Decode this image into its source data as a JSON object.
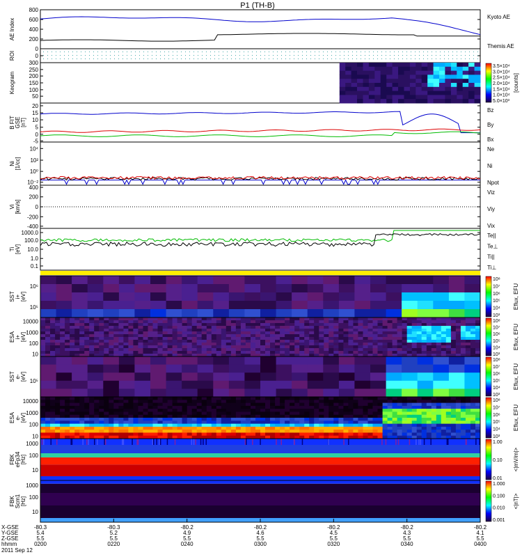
{
  "title": "P1 (TH-B)",
  "date": "2011 Sep 12",
  "ephem_labels": [
    "X-GSE",
    "Y-GSE",
    "Z-GSE",
    "hhmm"
  ],
  "ephem_values": {
    "x": [
      "-80.3",
      "-80.3",
      "-80.2",
      "-80.2",
      "-80.2",
      "-80.2",
      "-80.2"
    ],
    "y": [
      "5.4",
      "5.2",
      "4.9",
      "4.6",
      "4.5",
      "4.3",
      "4.1"
    ],
    "z": [
      "5.5",
      "5.5",
      "5.5",
      "5.5",
      "5.5",
      "5.5",
      "5.5"
    ],
    "hhmm": [
      "0200",
      "0220",
      "0240",
      "0300",
      "0320",
      "0340",
      "0400"
    ]
  },
  "colors": {
    "blue": "#0000cc",
    "red": "#dd0000",
    "green": "#00bb00",
    "black": "#000000",
    "yellow": "#ffee00"
  },
  "panels": [
    {
      "id": "ae",
      "ylabel": [
        "AE Index"
      ],
      "ticks": [
        "800",
        "600",
        "400",
        "200",
        "0"
      ],
      "legend": [
        {
          "text": "Kyoto AE",
          "color": "#0000cc"
        },
        {
          "text": "Themis AE",
          "color": "#000000"
        }
      ]
    },
    {
      "id": "roi",
      "ylabel": [
        "ROI"
      ],
      "ticks": [
        "0"
      ],
      "legend": []
    },
    {
      "id": "keogram",
      "ylabel": [
        "Keogram"
      ],
      "ticks": [
        "300",
        "250",
        "200",
        "150",
        "100",
        "50"
      ],
      "legend": []
    },
    {
      "id": "bfield",
      "ylabel": [
        "B FIT",
        "GSE",
        "[nT]"
      ],
      "ticks": [
        "20",
        "15",
        "10",
        "5",
        "0",
        "-5"
      ],
      "legend": [
        {
          "text": "Bz",
          "color": "#dd0000"
        },
        {
          "text": "By",
          "color": "#00bb00"
        },
        {
          "text": "Bx",
          "color": "#0000cc"
        }
      ]
    },
    {
      "id": "density",
      "ylabel": [
        "Ni",
        "[1/cc]"
      ],
      "ticks": [
        "10⁴",
        "10²",
        "10⁰",
        "10⁻²"
      ],
      "legend": [
        {
          "text": "Ne",
          "color": "#dd0000"
        },
        {
          "text": "Ni",
          "color": "#000000"
        },
        {
          "text": "Npot",
          "color": "#0000cc"
        }
      ]
    },
    {
      "id": "velocity",
      "ylabel": [
        "Vi",
        "[km/s]"
      ],
      "ticks": [
        "400",
        "200",
        "0",
        "-200",
        "-400"
      ],
      "legend": [
        {
          "text": "Viz",
          "color": "#dd0000"
        },
        {
          "text": "Viy",
          "color": "#00bb00"
        },
        {
          "text": "Vix",
          "color": "#0000cc"
        }
      ]
    },
    {
      "id": "temperature",
      "ylabel": [
        "Ti",
        "[eV]"
      ],
      "ticks": [
        "1000.0",
        "100.0",
        "10.0",
        "1.0",
        "0.1"
      ],
      "legend": [
        {
          "text": "Te||",
          "color": "#000000"
        },
        {
          "text": "Te⊥",
          "color": "#dd0000"
        },
        {
          "text": "Ti||",
          "color": "#00bb00"
        },
        {
          "text": "Ti⊥",
          "color": "#0000cc"
        }
      ]
    },
    {
      "id": "sst_ion",
      "ylabel": [
        "SST",
        "i+",
        "[eV]"
      ],
      "ticks": [
        "10⁶",
        "10⁵"
      ],
      "legend": []
    },
    {
      "id": "esa_ion",
      "ylabel": [
        "ESA",
        "i+",
        "[eV]"
      ],
      "ticks": [
        "10000",
        "1000",
        "100",
        "10"
      ],
      "legend": []
    },
    {
      "id": "sst_e",
      "ylabel": [
        "SST",
        "e-",
        "[eV]"
      ],
      "ticks": [
        "10⁵"
      ],
      "legend": []
    },
    {
      "id": "esa_e",
      "ylabel": [
        "ESA",
        "e-",
        "[eV]"
      ],
      "ticks": [
        "10000",
        "1000",
        "100",
        "10"
      ],
      "legend": []
    },
    {
      "id": "fbk_e",
      "ylabel": [
        "FBK",
        "eFp34",
        "[Hz]"
      ],
      "ticks": [
        "1000",
        "100",
        "10"
      ],
      "legend": []
    },
    {
      "id": "fbk_b",
      "ylabel": [
        "FBK",
        "Scm1",
        "[Hz]"
      ],
      "ticks": [
        "1000",
        "100",
        "10"
      ],
      "legend": []
    }
  ],
  "colorbars": [
    {
      "id": "cb_keo",
      "ticks": [
        "3.5×10⁴",
        "3.0×10⁴",
        "2.5×10⁴",
        "2.0×10⁴",
        "1.5×10⁴",
        "1.0×10⁴",
        "5.0×10³"
      ],
      "label": "[counts]"
    },
    {
      "id": "cb_sst_i",
      "ticks": [
        "10⁸",
        "10⁷",
        "10⁶",
        "10⁵",
        "10⁴",
        "10³"
      ],
      "label": "Eflux, EFU"
    },
    {
      "id": "cb_esa_i",
      "ticks": [
        "10⁸",
        "10⁷",
        "10⁶",
        "10⁵",
        "10⁴",
        "10³"
      ],
      "label": "Eflux, EFU"
    },
    {
      "id": "cb_sst_e",
      "ticks": [
        "10⁸",
        "10⁷",
        "10⁶",
        "10⁵",
        "10⁴",
        "10³"
      ],
      "label": "Eflux, EFU"
    },
    {
      "id": "cb_esa_e",
      "ticks": [
        "10⁸",
        "10⁷",
        "10⁶",
        "10⁵",
        "10⁴",
        "10³"
      ],
      "label": "Eflux, EFU"
    },
    {
      "id": "cb_fbk_e",
      "ticks": [
        "1.00",
        "0.10",
        "0.01"
      ],
      "label": "<|mV/m|>"
    },
    {
      "id": "cb_fbk_b",
      "ticks": [
        "1.000",
        "0.100",
        "0.010",
        "0.001"
      ],
      "label": "<|nT|>"
    }
  ],
  "chart_data": {
    "type": "line",
    "title": "P1 (TH-B)",
    "x": [
      "0200",
      "0220",
      "0240",
      "0300",
      "0320",
      "0340",
      "0400"
    ],
    "series": [
      {
        "name": "Kyoto AE",
        "values": [
          650,
          640,
          690,
          670,
          640,
          530,
          300
        ]
      },
      {
        "name": "Themis AE",
        "values": [
          160,
          180,
          300,
          310,
          300,
          250,
          240
        ]
      },
      {
        "name": "Bz",
        "values": [
          2,
          2,
          4,
          4,
          3,
          2,
          1
        ]
      },
      {
        "name": "By",
        "values": [
          -2,
          -2,
          -1,
          -1,
          -1,
          -1,
          0
        ]
      },
      {
        "name": "Bx",
        "values": [
          13,
          14,
          14,
          14,
          14,
          13,
          3
        ]
      }
    ]
  }
}
